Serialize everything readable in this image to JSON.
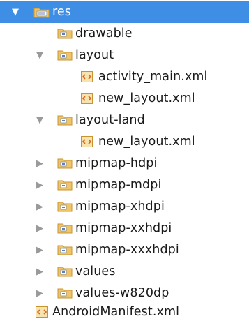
{
  "tree": {
    "root": {
      "label": "res",
      "icon": "resource-folder-icon",
      "expanded": true,
      "selected": true
    },
    "items": [
      {
        "label": "drawable",
        "icon": "folder-icon",
        "expanded": null
      },
      {
        "label": "layout",
        "icon": "folder-icon",
        "expanded": true
      },
      {
        "label": "activity_main.xml",
        "icon": "xml-file-icon",
        "expanded": null
      },
      {
        "label": "new_layout.xml",
        "icon": "xml-file-icon",
        "expanded": null
      },
      {
        "label": "layout-land",
        "icon": "folder-icon",
        "expanded": true
      },
      {
        "label": "new_layout.xml",
        "icon": "xml-file-icon",
        "expanded": null
      },
      {
        "label": "mipmap-hdpi",
        "icon": "folder-icon",
        "expanded": false
      },
      {
        "label": "mipmap-mdpi",
        "icon": "folder-icon",
        "expanded": false
      },
      {
        "label": "mipmap-xhdpi",
        "icon": "folder-icon",
        "expanded": false
      },
      {
        "label": "mipmap-xxhdpi",
        "icon": "folder-icon",
        "expanded": false
      },
      {
        "label": "mipmap-xxxhdpi",
        "icon": "folder-icon",
        "expanded": false
      },
      {
        "label": "values",
        "icon": "folder-icon",
        "expanded": false
      },
      {
        "label": "values-w820dp",
        "icon": "folder-icon",
        "expanded": false
      }
    ],
    "manifest": {
      "label": "AndroidManifest.xml",
      "icon": "manifest-file-icon"
    }
  },
  "colors": {
    "selection": "#3f8ee6",
    "folder": "#e8b24a",
    "text": "#1a1a1a"
  }
}
